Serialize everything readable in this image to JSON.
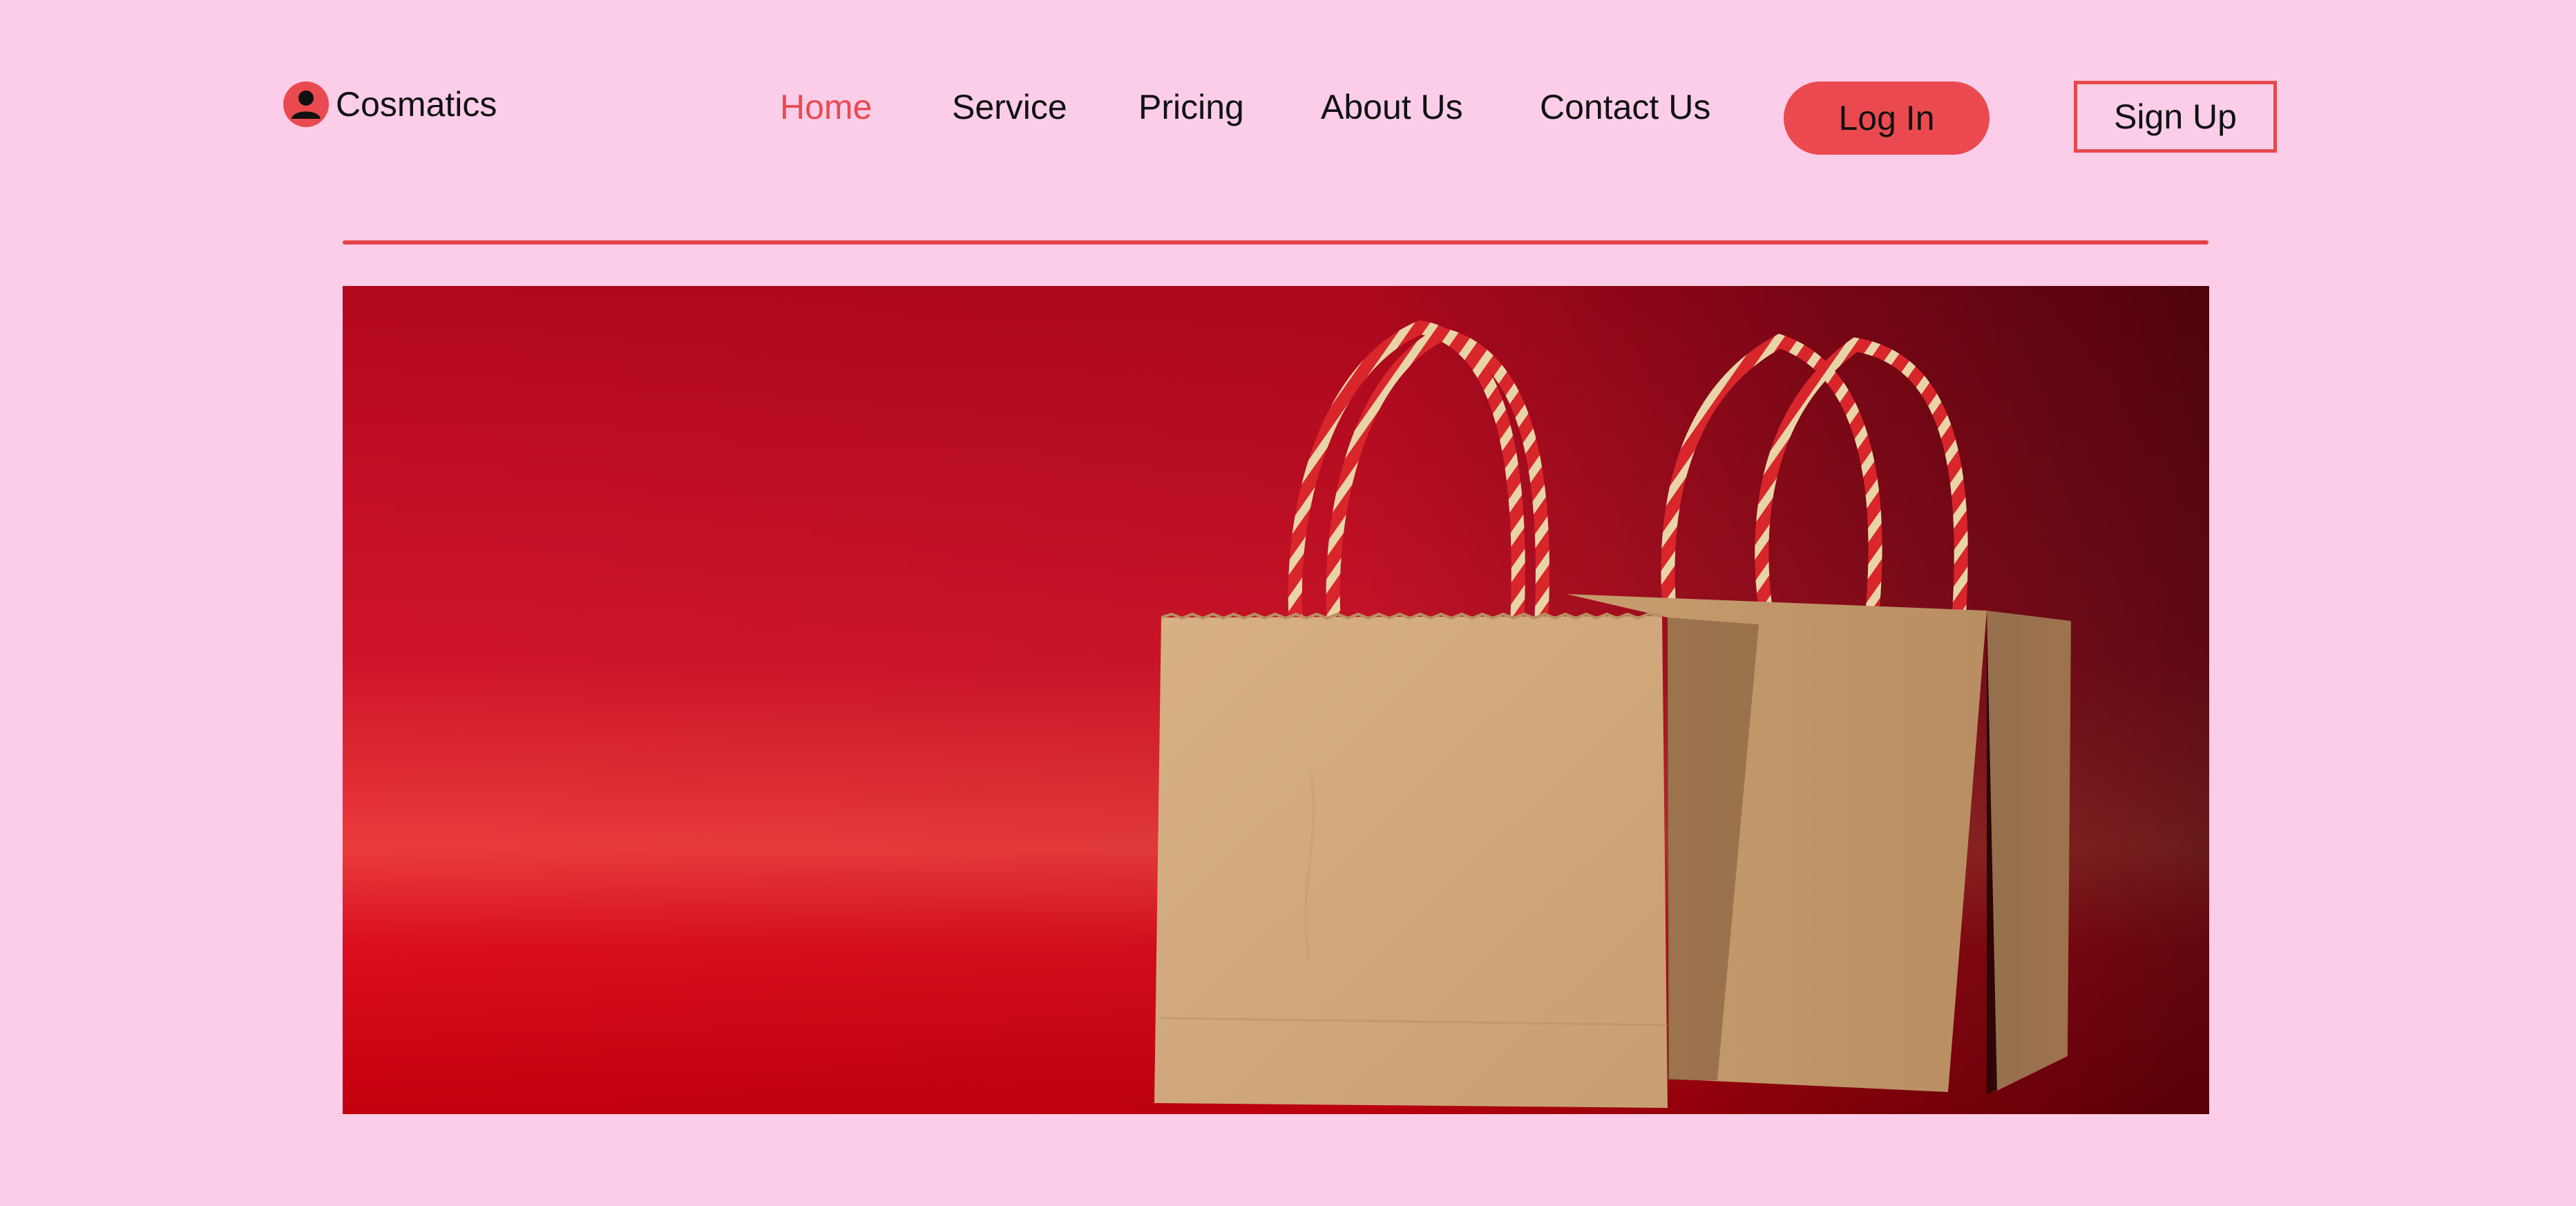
{
  "brand": {
    "name": "Cosmatics",
    "icon": "user-avatar-icon"
  },
  "nav": {
    "items": [
      {
        "label": "Home",
        "active": true
      },
      {
        "label": "Service",
        "active": false
      },
      {
        "label": "Pricing",
        "active": false
      },
      {
        "label": "About Us",
        "active": false
      },
      {
        "label": "Contact Us",
        "active": false
      }
    ]
  },
  "auth": {
    "login_label": "Log In",
    "signup_label": "Sign Up"
  },
  "colors": {
    "page_background": "#fbcde8",
    "accent": "#ea4a4f",
    "text": "#111111",
    "hero_background": "#c4081f",
    "paper_bag": "#d1aa7c"
  },
  "hero": {
    "image_subject": "shopping-bags-photo"
  }
}
